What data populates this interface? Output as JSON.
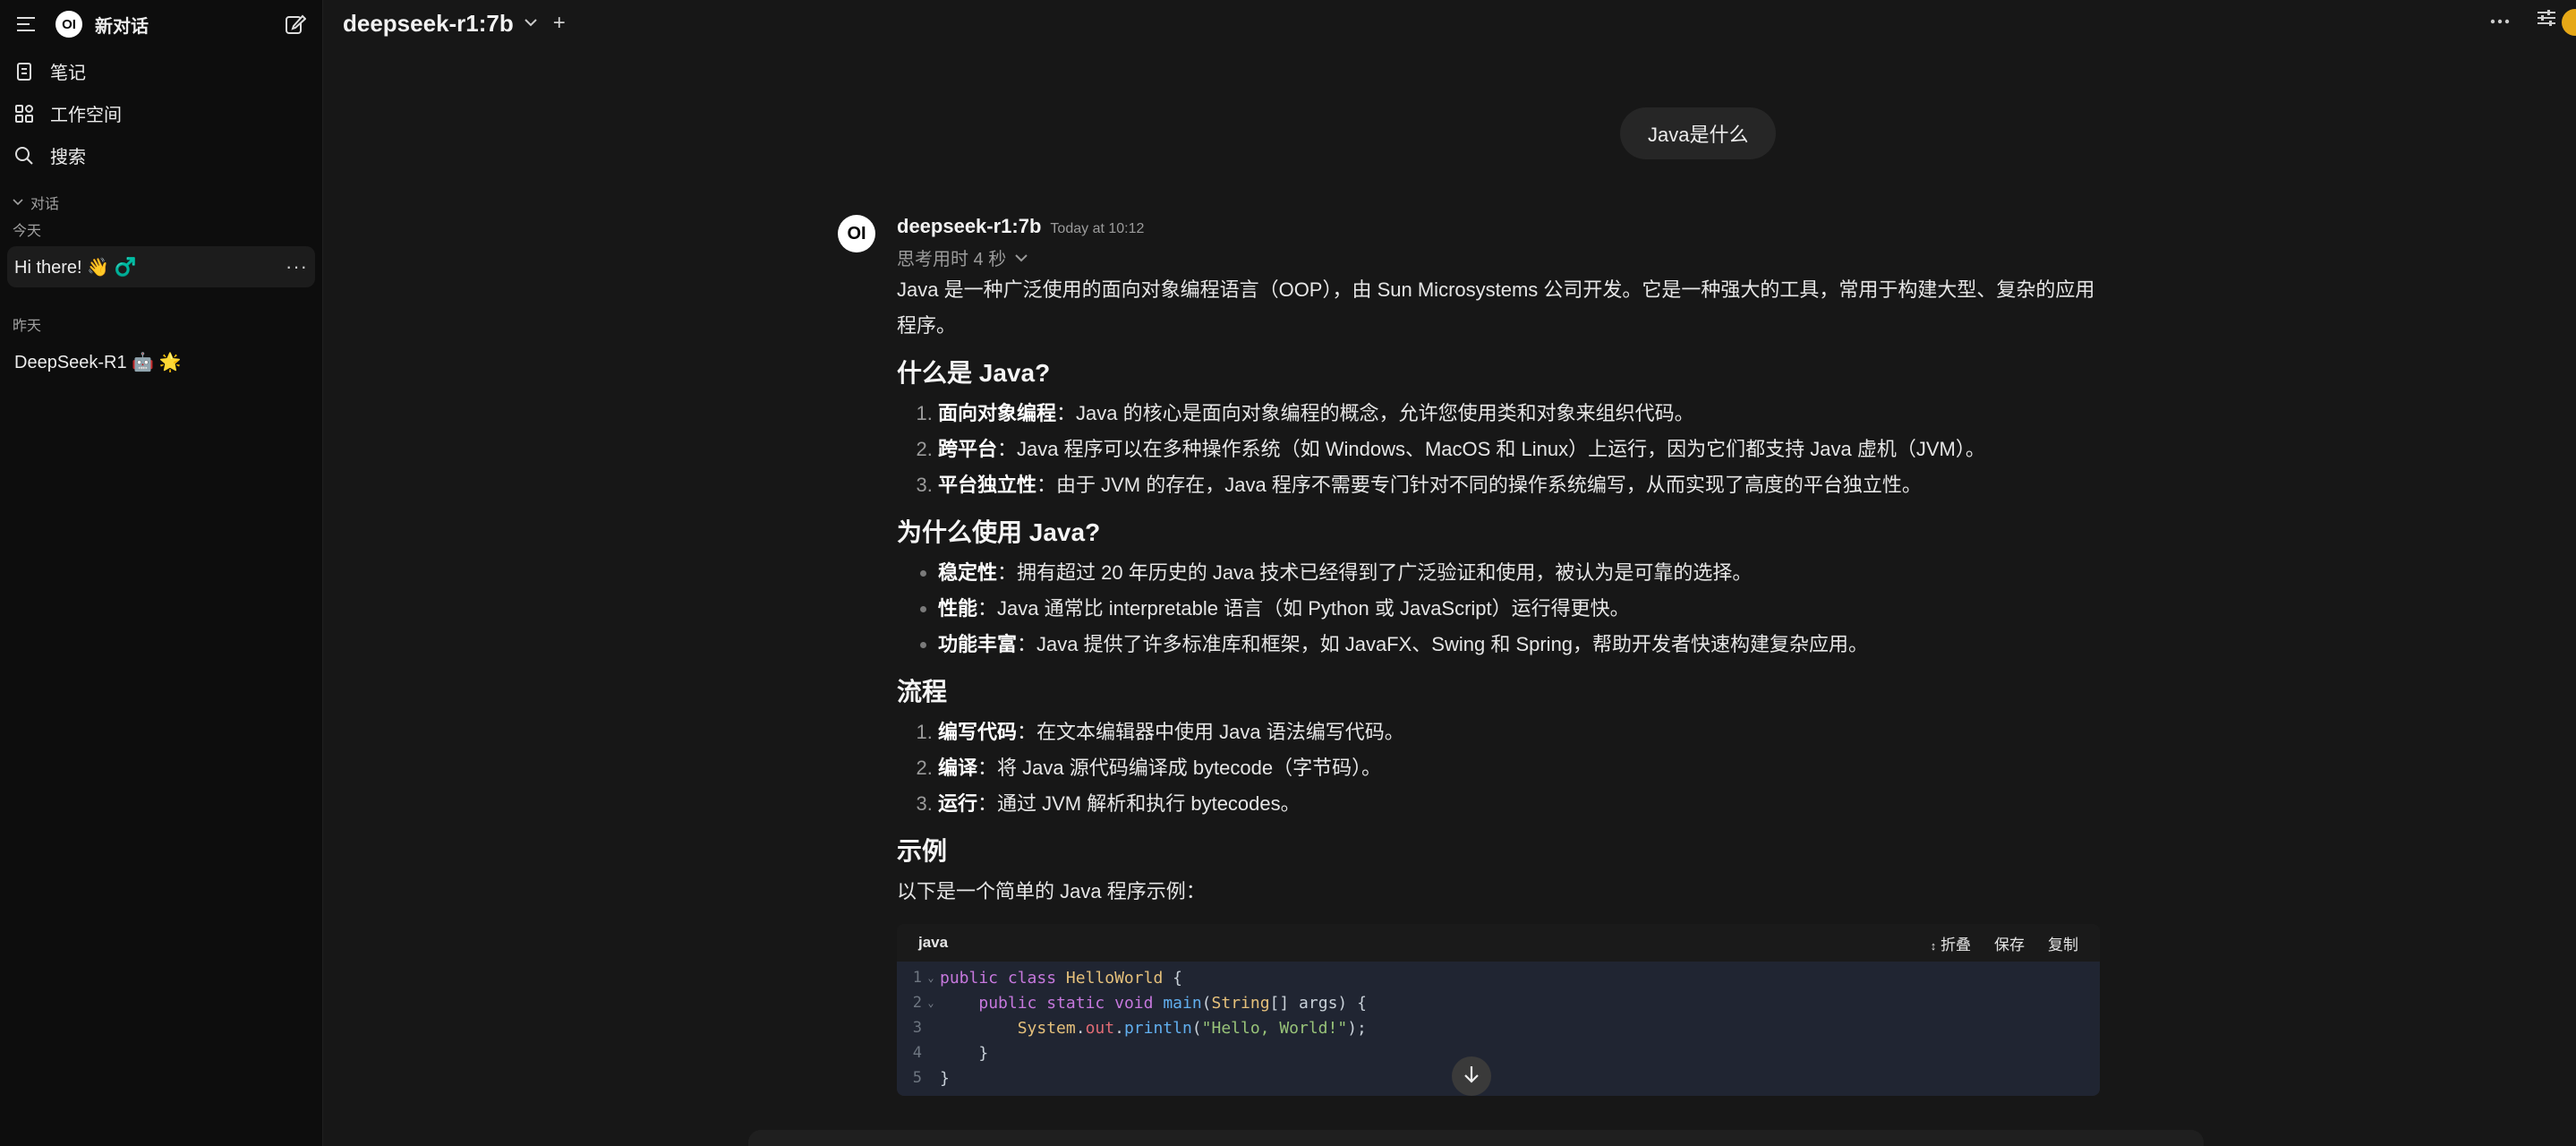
{
  "sidebar": {
    "title": "新对话",
    "logo_text": "OI",
    "nav": [
      {
        "label": "笔记",
        "icon": "notes-icon"
      },
      {
        "label": "工作空间",
        "icon": "workspace-icon"
      },
      {
        "label": "搜索",
        "icon": "search-icon"
      }
    ],
    "section_label": "对话",
    "groups": [
      {
        "label": "今天",
        "chats": [
          {
            "label": "Hi there! 👋 ♂️",
            "active": true
          }
        ]
      },
      {
        "label": "昨天",
        "chats": [
          {
            "label": "DeepSeek-R1 🤖 🌟",
            "active": false
          }
        ]
      }
    ]
  },
  "topbar": {
    "model": "deepseek-r1:7b",
    "plus": "+"
  },
  "user_message": "Java是什么",
  "assistant": {
    "avatar_text": "OI",
    "name": "deepseek-r1:7b",
    "time": "Today at 10:12",
    "thinking": "思考用时 4 秒",
    "intro": "Java 是一种广泛使用的面向对象编程语言（OOP），由 Sun Microsystems 公司开发。它是一种强大的工具，常用于构建大型、复杂的应用程序。",
    "sections": [
      {
        "title": "什么是 Java?",
        "ordered": true,
        "items": [
          {
            "key": "面向对象编程",
            "text": "：Java 的核心是面向对象编程的概念，允许您使用类和对象来组织代码。"
          },
          {
            "key": "跨平台",
            "text": "：Java 程序可以在多种操作系统（如 Windows、MacOS 和 Linux）上运行，因为它们都支持 Java 虚机（JVM）。"
          },
          {
            "key": "平台独立性",
            "text": "：由于 JVM 的存在，Java 程序不需要专门针对不同的操作系统编写，从而实现了高度的平台独立性。"
          }
        ]
      },
      {
        "title": "为什么使用 Java?",
        "ordered": false,
        "items": [
          {
            "key": "稳定性",
            "text": "：拥有超过 20 年历史的 Java 技术已经得到了广泛验证和使用，被认为是可靠的选择。"
          },
          {
            "key": "性能",
            "text": "：Java 通常比 interpretable 语言（如 Python 或 JavaScript）运行得更快。"
          },
          {
            "key": "功能丰富",
            "text": "：Java 提供了许多标准库和框架，如 JavaFX、Swing 和 Spring，帮助开发者快速构建复杂应用。"
          }
        ]
      },
      {
        "title": "流程",
        "ordered": true,
        "items": [
          {
            "key": "编写代码",
            "text": "：在文本编辑器中使用 Java 语法编写代码。"
          },
          {
            "key": "编译",
            "text": "：将 Java 源代码编译成 bytecode（字节码）。"
          },
          {
            "key": "运行",
            "text": "：通过 JVM 解析和执行 bytecodes。"
          }
        ]
      }
    ],
    "example_title": "示例",
    "example_intro": "以下是一个简单的 Java 程序示例：",
    "code": {
      "language": "java",
      "actions": {
        "fold": "折叠",
        "save": "保存",
        "copy": "复制"
      },
      "lines": [
        "public class HelloWorld {",
        "    public static void main(String[] args) {",
        "        System.out.println(\"Hello, World!\");",
        "    }",
        "}"
      ]
    }
  }
}
